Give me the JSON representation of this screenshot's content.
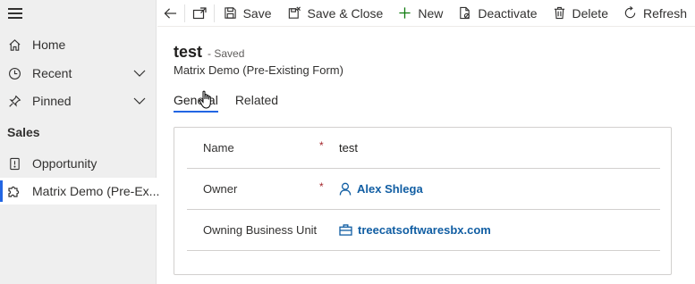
{
  "sidebar": {
    "items": [
      {
        "label": "Home",
        "icon": "home-icon"
      },
      {
        "label": "Recent",
        "icon": "clock-icon"
      },
      {
        "label": "Pinned",
        "icon": "pin-icon"
      }
    ],
    "group": "Sales",
    "entities": [
      {
        "label": "Opportunity",
        "icon": "opportunity-icon"
      },
      {
        "label": "Matrix Demo (Pre-Ex...",
        "icon": "puzzle-icon",
        "selected": true
      }
    ]
  },
  "command_bar": {
    "save": "Save",
    "save_close": "Save & Close",
    "new": "New",
    "deactivate": "Deactivate",
    "delete": "Delete",
    "refresh": "Refresh"
  },
  "record": {
    "name": "test",
    "status": "- Saved",
    "form_name": "Matrix Demo (Pre-Existing Form)"
  },
  "tabs": [
    "General",
    "Related"
  ],
  "fields": [
    {
      "label": "Name",
      "required": "*",
      "value": "test"
    },
    {
      "label": "Owner",
      "required": "*",
      "value": "Alex Shlega"
    },
    {
      "label": "Owning Business Unit",
      "value": "treecatsoftwaresbx.com"
    }
  ],
  "colors": {
    "accent": "#2266e3",
    "link": "#115ea3",
    "required": "#a4262c",
    "sidebar_bg": "#efefef"
  }
}
